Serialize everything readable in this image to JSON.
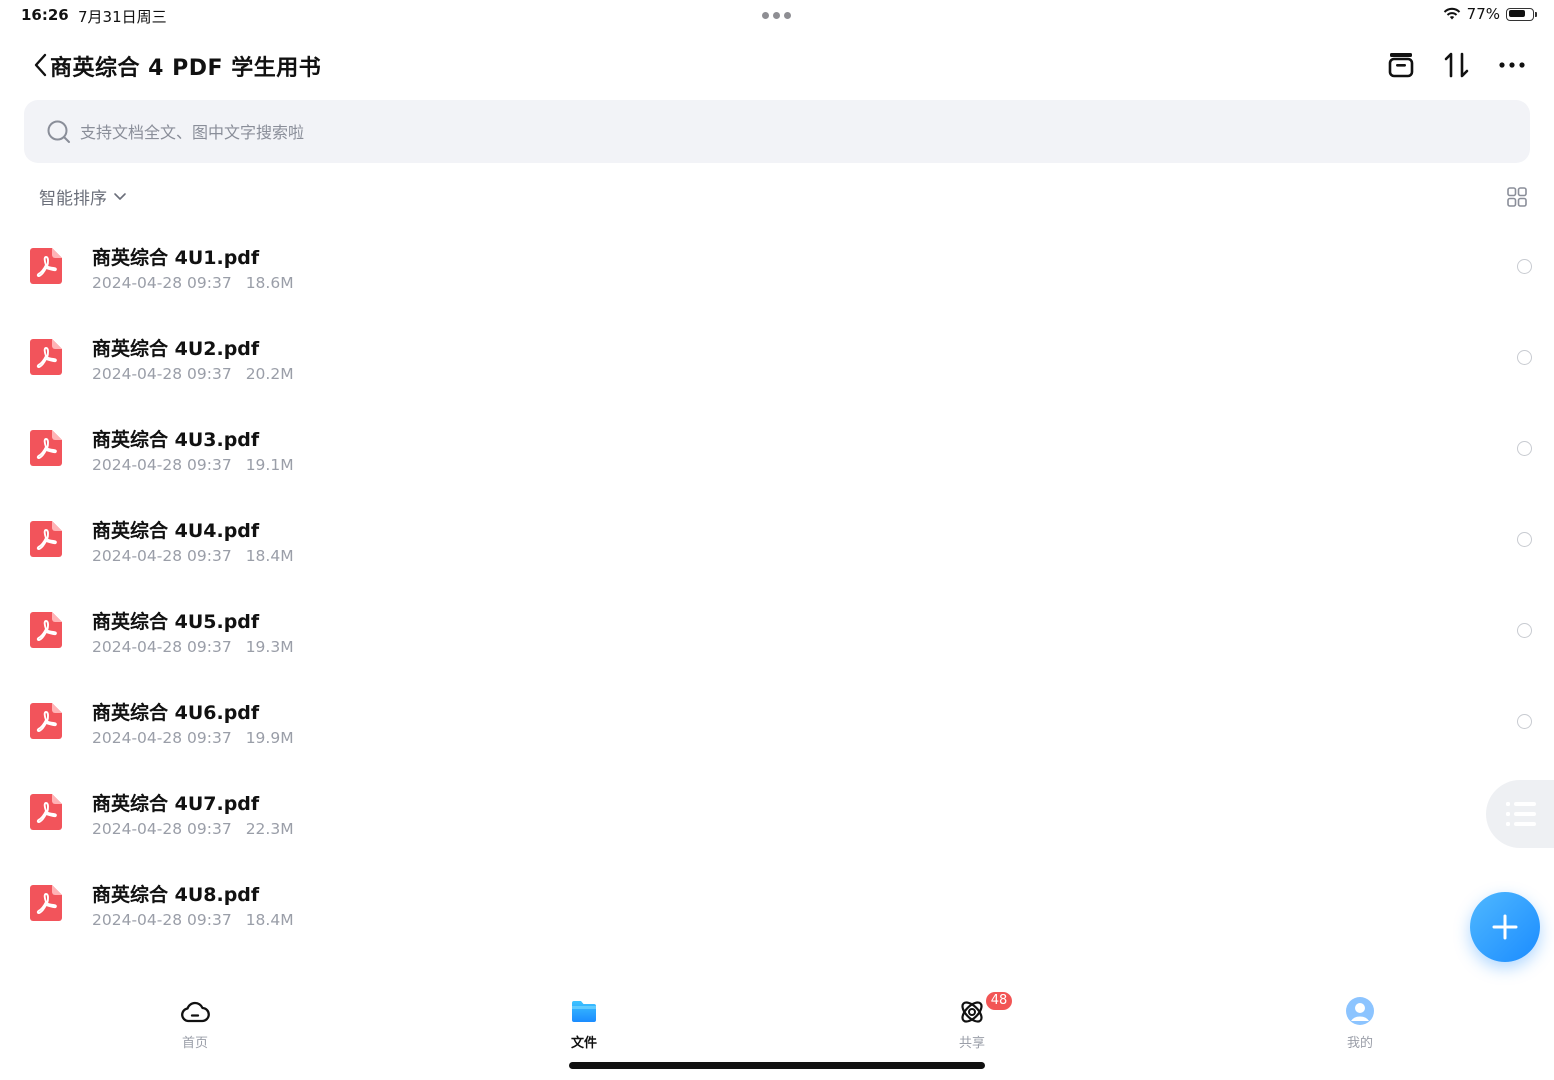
{
  "status_bar": {
    "time": "16:26",
    "date": "7月31日周三",
    "battery_percent": "77%",
    "battery_level": 0.77
  },
  "header": {
    "back_icon": "chevron-left-icon",
    "title": "商英综合 4 PDF 学生用书",
    "actions": [
      {
        "name": "archive-icon"
      },
      {
        "name": "sort-arrows-icon"
      },
      {
        "name": "more-icon"
      }
    ]
  },
  "search": {
    "placeholder": "支持文档全文、图中文字搜索啦",
    "value": ""
  },
  "sort": {
    "label": "智能排序",
    "view_toggle_icon": "grid-view-icon"
  },
  "files": [
    {
      "name": "商英综合 4U1.pdf",
      "date": "2024-04-28 09:37",
      "size": "18.6M"
    },
    {
      "name": "商英综合 4U2.pdf",
      "date": "2024-04-28 09:37",
      "size": "20.2M"
    },
    {
      "name": "商英综合 4U3.pdf",
      "date": "2024-04-28 09:37",
      "size": "19.1M"
    },
    {
      "name": "商英综合 4U4.pdf",
      "date": "2024-04-28 09:37",
      "size": "18.4M"
    },
    {
      "name": "商英综合 4U5.pdf",
      "date": "2024-04-28 09:37",
      "size": "19.3M"
    },
    {
      "name": "商英综合 4U6.pdf",
      "date": "2024-04-28 09:37",
      "size": "19.9M"
    },
    {
      "name": "商英综合 4U7.pdf",
      "date": "2024-04-28 09:37",
      "size": "22.3M"
    },
    {
      "name": "商英综合 4U8.pdf",
      "date": "2024-04-28 09:37",
      "size": "18.4M"
    }
  ],
  "tabs": [
    {
      "label": "首页",
      "icon": "cloud-icon",
      "active": false
    },
    {
      "label": "文件",
      "icon": "folder-icon",
      "active": true
    },
    {
      "label": "共享",
      "icon": "share-orbit-icon",
      "active": false,
      "badge": "48"
    },
    {
      "label": "我的",
      "icon": "avatar-icon",
      "active": false
    }
  ],
  "colors": {
    "accent": "#1b8cff",
    "pdf_red": "#f2545b",
    "badge": "#f25555",
    "search_bg": "#f2f3f7"
  }
}
